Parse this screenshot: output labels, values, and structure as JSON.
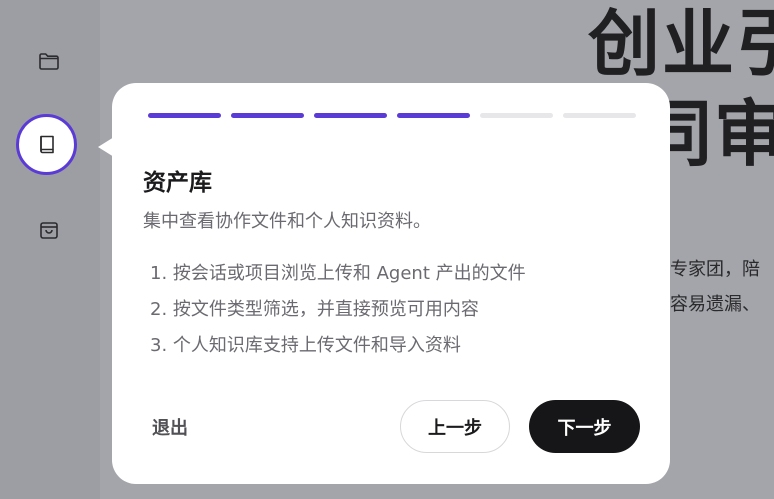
{
  "background": {
    "title_line1": "创业引",
    "title_line2": "同审",
    "text_line1": "专家团，陪",
    "text_line2": "容易遗漏、"
  },
  "sidebar": {
    "items": [
      {
        "icon": "folder-icon"
      },
      {
        "icon": "book-icon",
        "active": true
      },
      {
        "icon": "shopping-bag-icon"
      }
    ]
  },
  "tour": {
    "total_steps": 6,
    "current_step": 4,
    "title": "资产库",
    "description": "集中查看协作文件和个人知识资料。",
    "steps": [
      "1. 按会话或项目浏览上传和 Agent 产出的文件",
      "2. 按文件类型筛选，并直接预览可用内容",
      "3. 个人知识库支持上传文件和导入资料"
    ],
    "exit_label": "退出",
    "prev_label": "上一步",
    "next_label": "下一步"
  },
  "colors": {
    "accent": "#5b3bd6",
    "progress_inactive": "#e7e7e9",
    "primary_button": "#161618"
  }
}
